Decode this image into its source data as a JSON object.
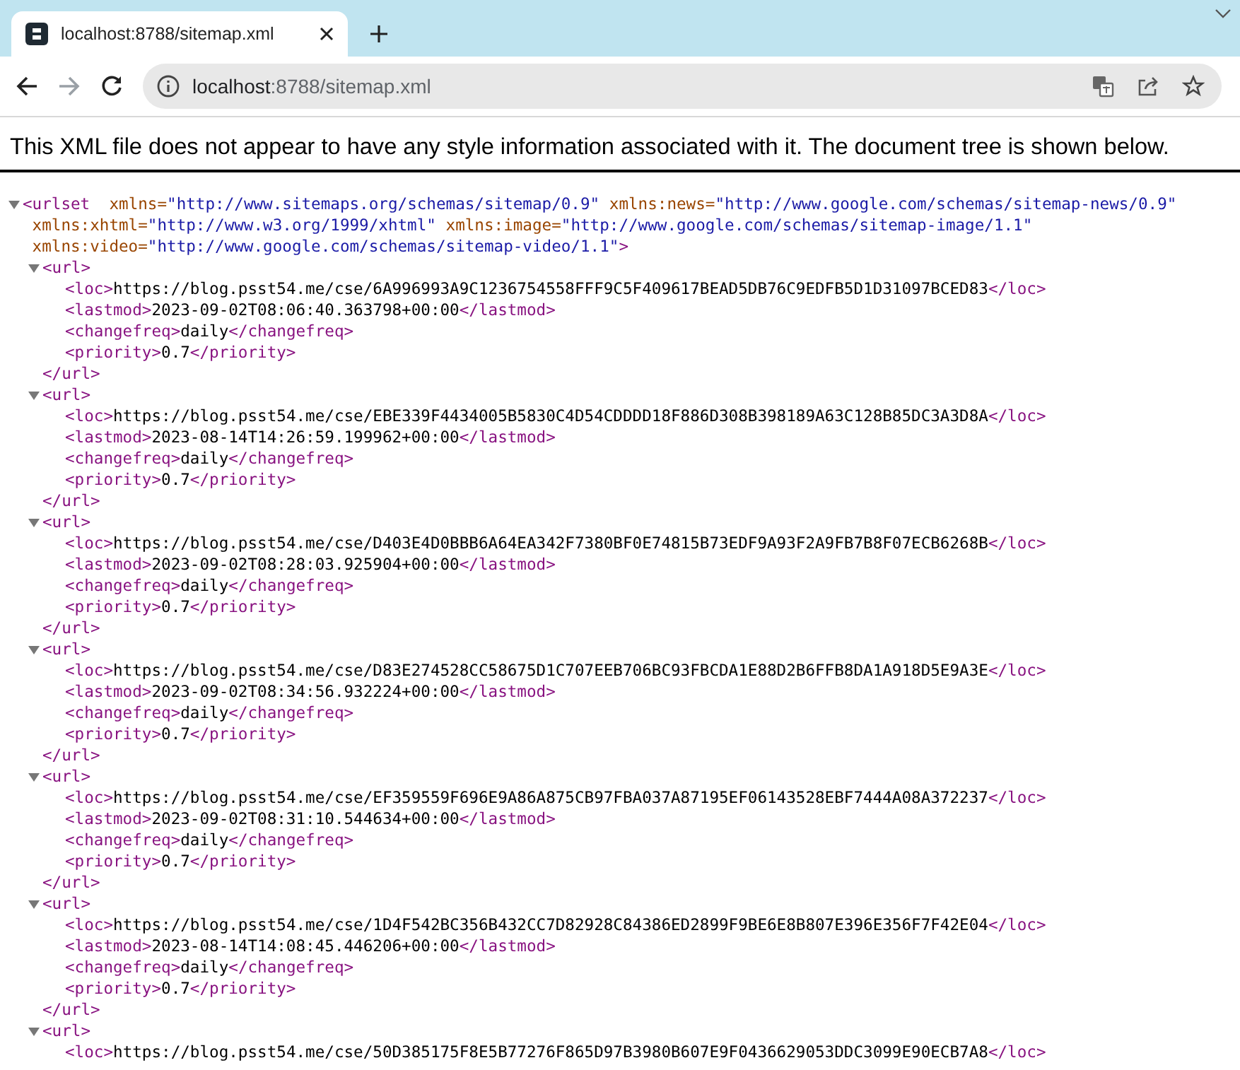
{
  "browser": {
    "tab": {
      "title": "localhost:8788/sitemap.xml",
      "selected": true
    },
    "forward_disabled": true,
    "address": {
      "host": "localhost",
      "path": ":8788/sitemap.xml"
    }
  },
  "notice": "This XML file does not appear to have any style information associated with it. The document tree is shown below.",
  "document": {
    "open": "<urlset",
    "open_end": ">",
    "expanded": true,
    "attributes": [
      {
        "name": "xmlns=",
        "value": "\"http://www.sitemaps.org/schemas/sitemap/0.9\""
      },
      {
        "name": "xmlns:news=",
        "value": "\"http://www.google.com/schemas/sitemap-news/0.9\""
      },
      {
        "name": "xmlns:xhtml=",
        "value": "\"http://www.w3.org/1999/xhtml\""
      },
      {
        "name": "xmlns:image=",
        "value": "\"http://www.google.com/schemas/sitemap-image/1.1\""
      },
      {
        "name": "xmlns:video=",
        "value": "\"http://www.google.com/schemas/sitemap-video/1.1\""
      }
    ],
    "children": [
      {
        "open": "<url>",
        "close": "</url>",
        "expanded": true,
        "children": [
          {
            "open": "<loc>",
            "text": "https://blog.psst54.me/cse/6A996993A9C1236754558FFF9C5F409617BEAD5DB76C9EDFB5D1D31097BCED83",
            "close": "</loc>"
          },
          {
            "open": "<lastmod>",
            "text": "2023-09-02T08:06:40.363798+00:00",
            "close": "</lastmod>"
          },
          {
            "open": "<changefreq>",
            "text": "daily",
            "close": "</changefreq>"
          },
          {
            "open": "<priority>",
            "text": "0.7",
            "close": "</priority>"
          }
        ]
      },
      {
        "open": "<url>",
        "close": "</url>",
        "expanded": true,
        "children": [
          {
            "open": "<loc>",
            "text": "https://blog.psst54.me/cse/EBE339F4434005B5830C4D54CDDDD18F886D308B398189A63C128B85DC3A3D8A",
            "close": "</loc>"
          },
          {
            "open": "<lastmod>",
            "text": "2023-08-14T14:26:59.199962+00:00",
            "close": "</lastmod>"
          },
          {
            "open": "<changefreq>",
            "text": "daily",
            "close": "</changefreq>"
          },
          {
            "open": "<priority>",
            "text": "0.7",
            "close": "</priority>"
          }
        ]
      },
      {
        "open": "<url>",
        "close": "</url>",
        "expanded": true,
        "children": [
          {
            "open": "<loc>",
            "text": "https://blog.psst54.me/cse/D403E4D0BBB6A64EA342F7380BF0E74815B73EDF9A93F2A9FB7B8F07ECB6268B",
            "close": "</loc>"
          },
          {
            "open": "<lastmod>",
            "text": "2023-09-02T08:28:03.925904+00:00",
            "close": "</lastmod>"
          },
          {
            "open": "<changefreq>",
            "text": "daily",
            "close": "</changefreq>"
          },
          {
            "open": "<priority>",
            "text": "0.7",
            "close": "</priority>"
          }
        ]
      },
      {
        "open": "<url>",
        "close": "</url>",
        "expanded": true,
        "children": [
          {
            "open": "<loc>",
            "text": "https://blog.psst54.me/cse/D83E274528CC58675D1C707EEB706BC93FBCDA1E88D2B6FFB8DA1A918D5E9A3E",
            "close": "</loc>"
          },
          {
            "open": "<lastmod>",
            "text": "2023-09-02T08:34:56.932224+00:00",
            "close": "</lastmod>"
          },
          {
            "open": "<changefreq>",
            "text": "daily",
            "close": "</changefreq>"
          },
          {
            "open": "<priority>",
            "text": "0.7",
            "close": "</priority>"
          }
        ]
      },
      {
        "open": "<url>",
        "close": "</url>",
        "expanded": true,
        "children": [
          {
            "open": "<loc>",
            "text": "https://blog.psst54.me/cse/EF359559F696E9A86A875CB97FBA037A87195EF06143528EBF7444A08A372237",
            "close": "</loc>"
          },
          {
            "open": "<lastmod>",
            "text": "2023-09-02T08:31:10.544634+00:00",
            "close": "</lastmod>"
          },
          {
            "open": "<changefreq>",
            "text": "daily",
            "close": "</changefreq>"
          },
          {
            "open": "<priority>",
            "text": "0.7",
            "close": "</priority>"
          }
        ]
      },
      {
        "open": "<url>",
        "close": "</url>",
        "expanded": true,
        "children": [
          {
            "open": "<loc>",
            "text": "https://blog.psst54.me/cse/1D4F542BC356B432CC7D82928C84386ED2899F9BE6E8B807E396E356F7F42E04",
            "close": "</loc>"
          },
          {
            "open": "<lastmod>",
            "text": "2023-08-14T14:08:45.446206+00:00",
            "close": "</lastmod>"
          },
          {
            "open": "<changefreq>",
            "text": "daily",
            "close": "</changefreq>"
          },
          {
            "open": "<priority>",
            "text": "0.7",
            "close": "</priority>"
          }
        ]
      },
      {
        "open": "<url>",
        "expanded": true,
        "children": [
          {
            "open": "<loc>",
            "text": "https://blog.psst54.me/cse/50D385175F8E5B77276F865D97B3980B607E9F0436629053DDC3099E90ECB7A8",
            "close": "</loc>"
          }
        ]
      }
    ]
  }
}
